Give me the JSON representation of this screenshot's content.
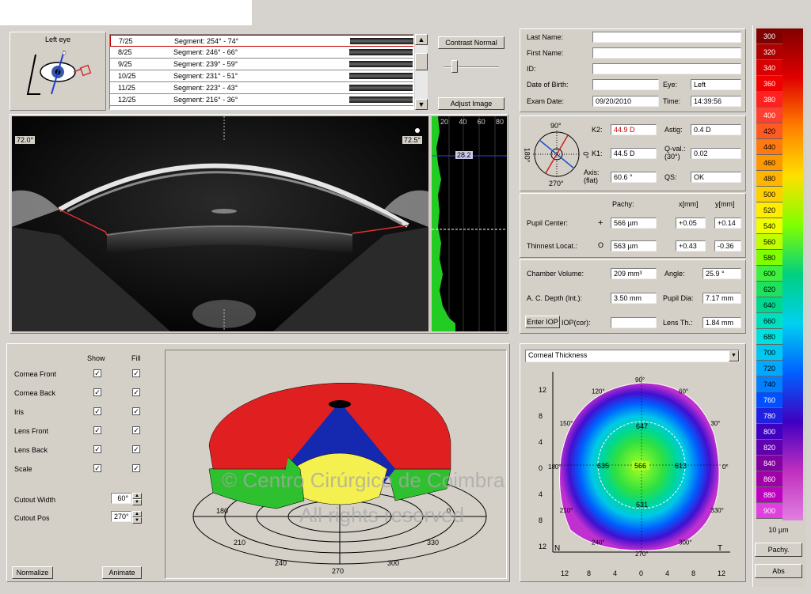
{
  "eye_panel": {
    "label": "Left eye"
  },
  "segments": [
    {
      "num": "7/25",
      "seg": "Segment: 254° - 74°"
    },
    {
      "num": "8/25",
      "seg": "Segment: 246° - 66°"
    },
    {
      "num": "9/25",
      "seg": "Segment: 239° - 59°"
    },
    {
      "num": "10/25",
      "seg": "Segment: 231° - 51°"
    },
    {
      "num": "11/25",
      "seg": "Segment: 223° - 43°"
    },
    {
      "num": "12/25",
      "seg": "Segment: 216° - 36°"
    }
  ],
  "image_controls": {
    "contrast_btn": "Contrast Normal",
    "adjust_btn": "Adjust Image"
  },
  "patient": {
    "last_name_label": "Last Name:",
    "first_name_label": "First Name:",
    "id_label": "ID:",
    "dob_label": "Date of Birth:",
    "exam_date_label": "Exam Date:",
    "exam_date": "09/20/2010",
    "eye_label": "Eye:",
    "eye": "Left",
    "time_label": "Time:",
    "time": "14:39:56"
  },
  "scheimpflug": {
    "angle_left": "72.0°",
    "angle_right": "72.5°"
  },
  "densitometry": {
    "ticks": [
      "20",
      "40",
      "60",
      "80"
    ],
    "value": "28.2"
  },
  "keratometry": {
    "k2_label": "K2:",
    "k2": "44.9 D",
    "k1_label": "K1:",
    "k1": "44.5 D",
    "axis_label": "Axis:\n(flat)",
    "axis": "60.6 °",
    "astig_label": "Astig:",
    "astig": "0.4 D",
    "qval_label": "Q-val.:\n(30°)",
    "qval": "0.02",
    "qs_label": "QS:",
    "qs": "OK",
    "dial": {
      "top": "90°",
      "right": "0°",
      "bottom": "270°",
      "left": "180°"
    }
  },
  "pachy": {
    "hdr_pachy": "Pachy:",
    "hdr_x": "x[mm]",
    "hdr_y": "y[mm]",
    "pupil_center_label": "Pupil Center:",
    "pupil_center_symbol": "+",
    "pupil_pachy": "566 µm",
    "pupil_x": "+0.05",
    "pupil_y": "+0.14",
    "thinnest_label": "Thinnest Locat.:",
    "thinnest_symbol": "O",
    "thinnest_pachy": "563 µm",
    "thinnest_x": "+0.43",
    "thinnest_y": "-0.36"
  },
  "chamber": {
    "volume_label": "Chamber Volume:",
    "volume": "209 mm³",
    "angle_label": "Angle:",
    "angle": "25.9 °",
    "acd_label": "A. C. Depth (Int.):",
    "acd": "3.50 mm",
    "pupil_dia_label": "Pupil Dia:",
    "pupil_dia": "7.17 mm",
    "enter_iop": "Enter IOP",
    "iop_label": "IOP(cor):",
    "iop": "",
    "lens_th_label": "Lens Th.:",
    "lens_th": "1.84 mm"
  },
  "layers": {
    "show_header": "Show",
    "fill_header": "Fill",
    "rows": [
      "Cornea Front",
      "Cornea Back",
      "Iris",
      "Lens Front",
      "Lens Back",
      "Scale"
    ],
    "cutout_width_label": "Cutout Width",
    "cutout_width": "60°",
    "cutout_pos_label": "Cutout Pos",
    "cutout_pos": "270°",
    "normalize": "Normalize",
    "animate": "Animate"
  },
  "view3d": {
    "axis_labels": [
      "180",
      "210",
      "240",
      "270",
      "300",
      "330",
      "0"
    ],
    "watermark1": "© Centro Cirúrgico de Coimbra",
    "watermark2": "All rights reserved"
  },
  "map": {
    "type": "Corneal Thickness",
    "values": {
      "center": "566",
      "top": "647",
      "left": "635",
      "right": "613",
      "bottom": "631"
    },
    "y_ticks": [
      "12",
      "8",
      "4",
      "0",
      "4",
      "8",
      "12"
    ],
    "x_ticks": [
      "12",
      "8",
      "4",
      "0",
      "4",
      "8",
      "12"
    ],
    "nasal": "N",
    "temporal": "T",
    "angles": [
      "90°",
      "60°",
      "30°",
      "0°",
      "330°",
      "300°",
      "270°",
      "240°",
      "210°",
      "180°",
      "150°",
      "120°"
    ]
  },
  "color_scale": {
    "values": [
      "300",
      "320",
      "340",
      "360",
      "380",
      "400",
      "420",
      "440",
      "460",
      "480",
      "500",
      "520",
      "540",
      "560",
      "580",
      "600",
      "620",
      "640",
      "660",
      "680",
      "700",
      "720",
      "740",
      "760",
      "780",
      "800",
      "820",
      "840",
      "860",
      "880",
      "900"
    ],
    "colors": [
      "#800000",
      "#b00000",
      "#d80000",
      "#f00000",
      "#ff2020",
      "#ff4030",
      "#ff5a20",
      "#ff7a10",
      "#ff9800",
      "#ffb400",
      "#ffd000",
      "#ffec00",
      "#f0ff00",
      "#c0ff00",
      "#80ff00",
      "#40f040",
      "#20e060",
      "#00d890",
      "#00e0c0",
      "#00e0e0",
      "#00c8f0",
      "#00a8ff",
      "#0080ff",
      "#0050ff",
      "#2020e0",
      "#4000c0",
      "#6000b0",
      "#8000a0",
      "#a000a8",
      "#c000c0",
      "#e040e0"
    ],
    "step": "10 µm",
    "pachy_btn": "Pachy.",
    "abs_btn": "Abs"
  }
}
